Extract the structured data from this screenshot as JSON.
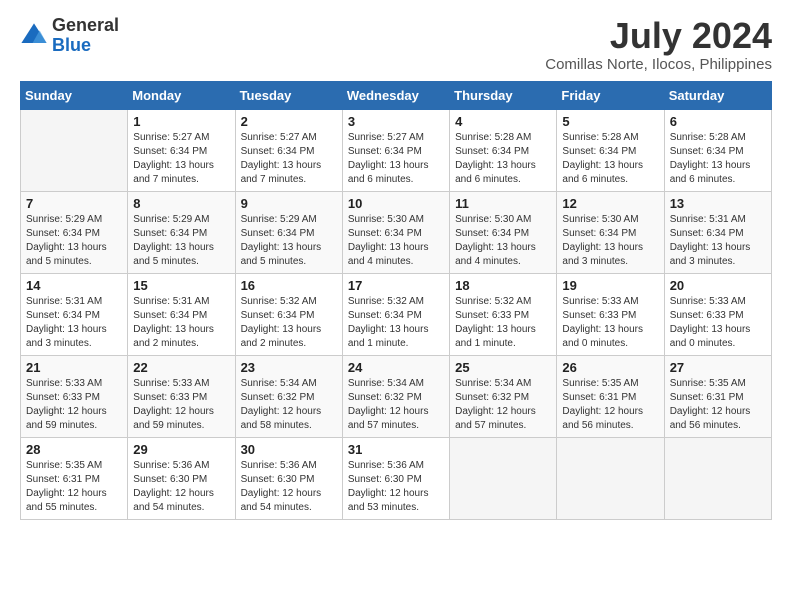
{
  "logo": {
    "general": "General",
    "blue": "Blue"
  },
  "title": "July 2024",
  "location": "Comillas Norte, Ilocos, Philippines",
  "weekdays": [
    "Sunday",
    "Monday",
    "Tuesday",
    "Wednesday",
    "Thursday",
    "Friday",
    "Saturday"
  ],
  "weeks": [
    [
      {
        "day": "",
        "sunrise": "",
        "sunset": "",
        "daylight": ""
      },
      {
        "day": "1",
        "sunrise": "Sunrise: 5:27 AM",
        "sunset": "Sunset: 6:34 PM",
        "daylight": "Daylight: 13 hours and 7 minutes."
      },
      {
        "day": "2",
        "sunrise": "Sunrise: 5:27 AM",
        "sunset": "Sunset: 6:34 PM",
        "daylight": "Daylight: 13 hours and 7 minutes."
      },
      {
        "day": "3",
        "sunrise": "Sunrise: 5:27 AM",
        "sunset": "Sunset: 6:34 PM",
        "daylight": "Daylight: 13 hours and 6 minutes."
      },
      {
        "day": "4",
        "sunrise": "Sunrise: 5:28 AM",
        "sunset": "Sunset: 6:34 PM",
        "daylight": "Daylight: 13 hours and 6 minutes."
      },
      {
        "day": "5",
        "sunrise": "Sunrise: 5:28 AM",
        "sunset": "Sunset: 6:34 PM",
        "daylight": "Daylight: 13 hours and 6 minutes."
      },
      {
        "day": "6",
        "sunrise": "Sunrise: 5:28 AM",
        "sunset": "Sunset: 6:34 PM",
        "daylight": "Daylight: 13 hours and 6 minutes."
      }
    ],
    [
      {
        "day": "7",
        "sunrise": "Sunrise: 5:29 AM",
        "sunset": "Sunset: 6:34 PM",
        "daylight": "Daylight: 13 hours and 5 minutes."
      },
      {
        "day": "8",
        "sunrise": "Sunrise: 5:29 AM",
        "sunset": "Sunset: 6:34 PM",
        "daylight": "Daylight: 13 hours and 5 minutes."
      },
      {
        "day": "9",
        "sunrise": "Sunrise: 5:29 AM",
        "sunset": "Sunset: 6:34 PM",
        "daylight": "Daylight: 13 hours and 5 minutes."
      },
      {
        "day": "10",
        "sunrise": "Sunrise: 5:30 AM",
        "sunset": "Sunset: 6:34 PM",
        "daylight": "Daylight: 13 hours and 4 minutes."
      },
      {
        "day": "11",
        "sunrise": "Sunrise: 5:30 AM",
        "sunset": "Sunset: 6:34 PM",
        "daylight": "Daylight: 13 hours and 4 minutes."
      },
      {
        "day": "12",
        "sunrise": "Sunrise: 5:30 AM",
        "sunset": "Sunset: 6:34 PM",
        "daylight": "Daylight: 13 hours and 3 minutes."
      },
      {
        "day": "13",
        "sunrise": "Sunrise: 5:31 AM",
        "sunset": "Sunset: 6:34 PM",
        "daylight": "Daylight: 13 hours and 3 minutes."
      }
    ],
    [
      {
        "day": "14",
        "sunrise": "Sunrise: 5:31 AM",
        "sunset": "Sunset: 6:34 PM",
        "daylight": "Daylight: 13 hours and 3 minutes."
      },
      {
        "day": "15",
        "sunrise": "Sunrise: 5:31 AM",
        "sunset": "Sunset: 6:34 PM",
        "daylight": "Daylight: 13 hours and 2 minutes."
      },
      {
        "day": "16",
        "sunrise": "Sunrise: 5:32 AM",
        "sunset": "Sunset: 6:34 PM",
        "daylight": "Daylight: 13 hours and 2 minutes."
      },
      {
        "day": "17",
        "sunrise": "Sunrise: 5:32 AM",
        "sunset": "Sunset: 6:34 PM",
        "daylight": "Daylight: 13 hours and 1 minute."
      },
      {
        "day": "18",
        "sunrise": "Sunrise: 5:32 AM",
        "sunset": "Sunset: 6:33 PM",
        "daylight": "Daylight: 13 hours and 1 minute."
      },
      {
        "day": "19",
        "sunrise": "Sunrise: 5:33 AM",
        "sunset": "Sunset: 6:33 PM",
        "daylight": "Daylight: 13 hours and 0 minutes."
      },
      {
        "day": "20",
        "sunrise": "Sunrise: 5:33 AM",
        "sunset": "Sunset: 6:33 PM",
        "daylight": "Daylight: 13 hours and 0 minutes."
      }
    ],
    [
      {
        "day": "21",
        "sunrise": "Sunrise: 5:33 AM",
        "sunset": "Sunset: 6:33 PM",
        "daylight": "Daylight: 12 hours and 59 minutes."
      },
      {
        "day": "22",
        "sunrise": "Sunrise: 5:33 AM",
        "sunset": "Sunset: 6:33 PM",
        "daylight": "Daylight: 12 hours and 59 minutes."
      },
      {
        "day": "23",
        "sunrise": "Sunrise: 5:34 AM",
        "sunset": "Sunset: 6:32 PM",
        "daylight": "Daylight: 12 hours and 58 minutes."
      },
      {
        "day": "24",
        "sunrise": "Sunrise: 5:34 AM",
        "sunset": "Sunset: 6:32 PM",
        "daylight": "Daylight: 12 hours and 57 minutes."
      },
      {
        "day": "25",
        "sunrise": "Sunrise: 5:34 AM",
        "sunset": "Sunset: 6:32 PM",
        "daylight": "Daylight: 12 hours and 57 minutes."
      },
      {
        "day": "26",
        "sunrise": "Sunrise: 5:35 AM",
        "sunset": "Sunset: 6:31 PM",
        "daylight": "Daylight: 12 hours and 56 minutes."
      },
      {
        "day": "27",
        "sunrise": "Sunrise: 5:35 AM",
        "sunset": "Sunset: 6:31 PM",
        "daylight": "Daylight: 12 hours and 56 minutes."
      }
    ],
    [
      {
        "day": "28",
        "sunrise": "Sunrise: 5:35 AM",
        "sunset": "Sunset: 6:31 PM",
        "daylight": "Daylight: 12 hours and 55 minutes."
      },
      {
        "day": "29",
        "sunrise": "Sunrise: 5:36 AM",
        "sunset": "Sunset: 6:30 PM",
        "daylight": "Daylight: 12 hours and 54 minutes."
      },
      {
        "day": "30",
        "sunrise": "Sunrise: 5:36 AM",
        "sunset": "Sunset: 6:30 PM",
        "daylight": "Daylight: 12 hours and 54 minutes."
      },
      {
        "day": "31",
        "sunrise": "Sunrise: 5:36 AM",
        "sunset": "Sunset: 6:30 PM",
        "daylight": "Daylight: 12 hours and 53 minutes."
      },
      {
        "day": "",
        "sunrise": "",
        "sunset": "",
        "daylight": ""
      },
      {
        "day": "",
        "sunrise": "",
        "sunset": "",
        "daylight": ""
      },
      {
        "day": "",
        "sunrise": "",
        "sunset": "",
        "daylight": ""
      }
    ]
  ]
}
